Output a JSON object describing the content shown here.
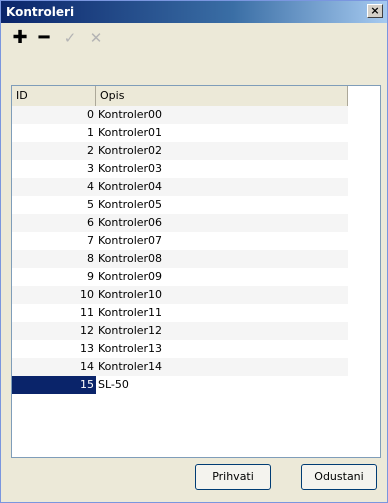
{
  "window": {
    "title": "Kontroleri",
    "close_symbol": "×"
  },
  "toolbar": {
    "add_icon": "✚",
    "remove_icon": "━",
    "confirm_icon": "✓",
    "cancel_icon": "✕"
  },
  "table": {
    "columns": [
      "ID",
      "Opis"
    ],
    "rows": [
      {
        "id": "0",
        "opis": "Kontroler00"
      },
      {
        "id": "1",
        "opis": "Kontroler01"
      },
      {
        "id": "2",
        "opis": "Kontroler02"
      },
      {
        "id": "3",
        "opis": "Kontroler03"
      },
      {
        "id": "4",
        "opis": "Kontroler04"
      },
      {
        "id": "5",
        "opis": "Kontroler05"
      },
      {
        "id": "6",
        "opis": "Kontroler06"
      },
      {
        "id": "7",
        "opis": "Kontroler07"
      },
      {
        "id": "8",
        "opis": "Kontroler08"
      },
      {
        "id": "9",
        "opis": "Kontroler09"
      },
      {
        "id": "10",
        "opis": "Kontroler10"
      },
      {
        "id": "11",
        "opis": "Kontroler11"
      },
      {
        "id": "12",
        "opis": "Kontroler12"
      },
      {
        "id": "13",
        "opis": "Kontroler13"
      },
      {
        "id": "14",
        "opis": "Kontroler14"
      },
      {
        "id": "15",
        "opis": "SL-50"
      }
    ],
    "selected_row": 15
  },
  "footer": {
    "accept_label": "Prihvati",
    "cancel_label": "Odustani"
  }
}
